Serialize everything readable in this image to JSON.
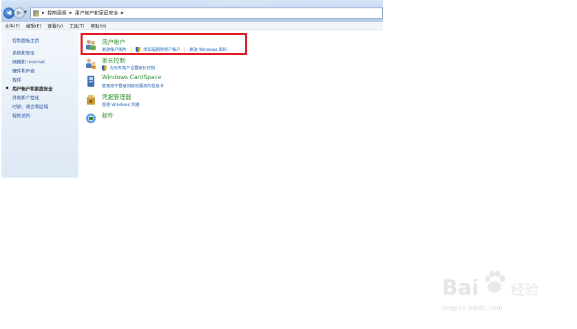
{
  "window": {
    "title_faint": "Microsoft Office Word 2007"
  },
  "address": {
    "crumbs": [
      "控制面板",
      "用户帐户和家庭安全"
    ]
  },
  "menubar": {
    "items": [
      "文件(F)",
      "编辑(E)",
      "查看(V)",
      "工具(T)",
      "帮助(H)"
    ]
  },
  "sidebar": {
    "items": [
      {
        "label": "控制面板主页"
      },
      {
        "label": "系统和安全"
      },
      {
        "label": "网络和 Internet"
      },
      {
        "label": "硬件和声音"
      },
      {
        "label": "程序"
      },
      {
        "label": "用户帐户和家庭安全",
        "active": true
      },
      {
        "label": "外观和个性化"
      },
      {
        "label": "时钟、语言和区域"
      },
      {
        "label": "轻松访问"
      }
    ]
  },
  "categories": [
    {
      "title": "用户帐户",
      "icon": "users-icon",
      "links": [
        "更改帐户图片",
        "添加或删除用户帐户",
        "更改 Windows 密码"
      ]
    },
    {
      "title": "家长控制",
      "icon": "parental-control-icon",
      "links": [
        "为所有用户设置家长控制"
      ]
    },
    {
      "title": "Windows CardSpace",
      "icon": "cardspace-icon",
      "links": [
        "管理用于登录到联机服务的信息卡"
      ]
    },
    {
      "title": "凭据管理器",
      "icon": "credential-manager-icon",
      "links": [
        "管理 Windows 凭据"
      ]
    },
    {
      "title": "邮件",
      "icon": "mail-icon",
      "links": []
    }
  ],
  "watermark": {
    "brand": "Bai",
    "brand_cn": "经验",
    "url": "jingyan.baidu.com"
  },
  "colors": {
    "category_title": "#2a8b2a",
    "link": "#1a5fb4",
    "highlight": "#e01b24"
  }
}
